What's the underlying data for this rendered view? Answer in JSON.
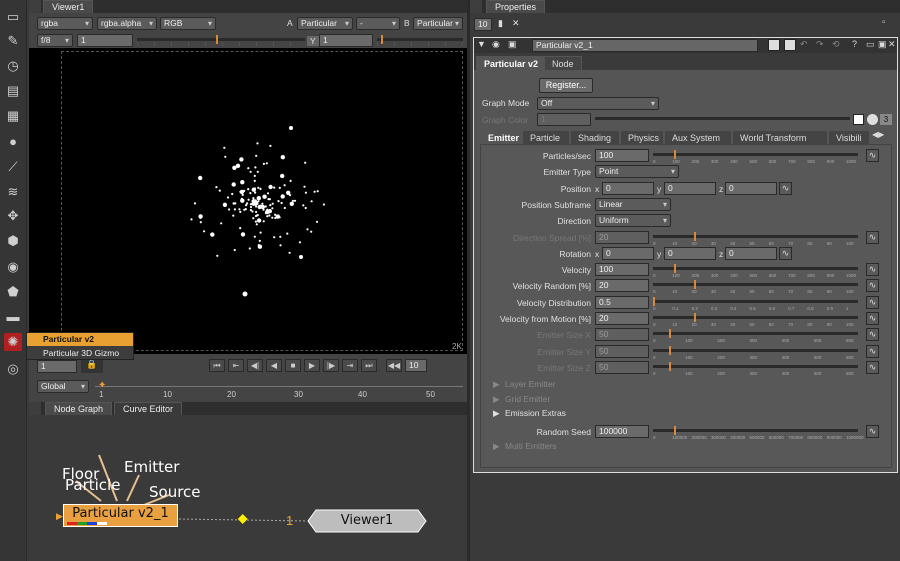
{
  "viewer": {
    "tab": "Viewer1",
    "channels": "rgba",
    "alpha": "rgba.alpha",
    "colorspace": "RGB",
    "a_label": "A",
    "a_input": "Particular",
    "dash": "-",
    "b_label": "B",
    "b_input": "Particular",
    "fstop": "f/8",
    "gain": "1",
    "y_label": "Y",
    "gamma": "1",
    "res_label": "2K"
  },
  "menu": {
    "items": [
      "Particular v2",
      "Particular 3D Gizmo"
    ]
  },
  "timeline": {
    "frame": "1",
    "mode": "Global",
    "ticks": [
      "1",
      "10",
      "20",
      "30",
      "40",
      "50"
    ],
    "fps": "10"
  },
  "graph": {
    "tabs": [
      "Node Graph",
      "Curve Editor"
    ],
    "inputs": [
      "Floor",
      "Particle",
      "Emitter",
      "Source"
    ],
    "node_label": "Particular v2_1",
    "viewer_node": "Viewer1",
    "viewer_input_num": "1"
  },
  "properties": {
    "tab": "Properties",
    "count": "10",
    "node_name": "Particular v2_1",
    "tabs": [
      "Particular v2",
      "Node"
    ],
    "register": "Register...",
    "graph_mode_label": "Graph Mode",
    "graph_mode": "Off",
    "graph_color_label": "Graph Color",
    "graph_color_value": "1",
    "graph_color_count": "3",
    "subtabs": [
      "Emitter",
      "Particle",
      "Shading",
      "Physics",
      "Aux System",
      "World Transform",
      "Visibili"
    ],
    "rows": [
      {
        "label": "Particles/sec",
        "value": "100"
      },
      {
        "label": "Emitter Type",
        "value": "Point"
      },
      {
        "label": "Position",
        "x": "0",
        "y": "0",
        "z": "0"
      },
      {
        "label": "Position Subframe",
        "value": "Linear"
      },
      {
        "label": "Direction",
        "value": "Uniform"
      },
      {
        "label": "Direction Spread [%]",
        "value": "20"
      },
      {
        "label": "Rotation",
        "x": "0",
        "y": "0",
        "z": "0"
      },
      {
        "label": "Velocity",
        "value": "100"
      },
      {
        "label": "Velocity Random [%]",
        "value": "20"
      },
      {
        "label": "Velocity Distribution",
        "value": "0.5"
      },
      {
        "label": "Velocity from Motion [%]",
        "value": "20"
      },
      {
        "label": "Emitter Size X",
        "value": "50"
      },
      {
        "label": "Emitter Size Y",
        "value": "50"
      },
      {
        "label": "Emitter Size Z",
        "value": "50"
      }
    ],
    "groups": [
      "Layer Emitter",
      "Grid Emitter",
      "Emission Extras"
    ],
    "seed_label": "Random Seed",
    "seed": "100000",
    "multi": "Multi Emitters",
    "scale_labels": {
      "s1000": [
        "0",
        "100",
        "200",
        "300",
        "400",
        "500",
        "600",
        "700",
        "800",
        "900",
        "1000"
      ],
      "s100": [
        "0",
        "10",
        "20",
        "30",
        "40",
        "50",
        "60",
        "70",
        "80",
        "90",
        "100"
      ],
      "s1": [
        "0",
        "0.1",
        "0.2",
        "0.3",
        "0.4",
        "0.5",
        "0.6",
        "0.7",
        "0.8",
        "0.9",
        "1"
      ],
      "s10": [
        "0",
        "10",
        "20",
        "30",
        "40",
        "50",
        "60",
        "70",
        "80",
        "90",
        "100"
      ],
      "s600": [
        "0",
        "100",
        "200",
        "300",
        "400",
        "500",
        "600"
      ],
      "seed": [
        "0",
        "100000",
        "200000",
        "300000",
        "400000",
        "500000",
        "600000",
        "700000",
        "800000",
        "900000",
        "1000000"
      ]
    }
  },
  "colors": {
    "accent": "#f0a030",
    "node": "#e8a040",
    "menu_bg": "#e8a030"
  }
}
